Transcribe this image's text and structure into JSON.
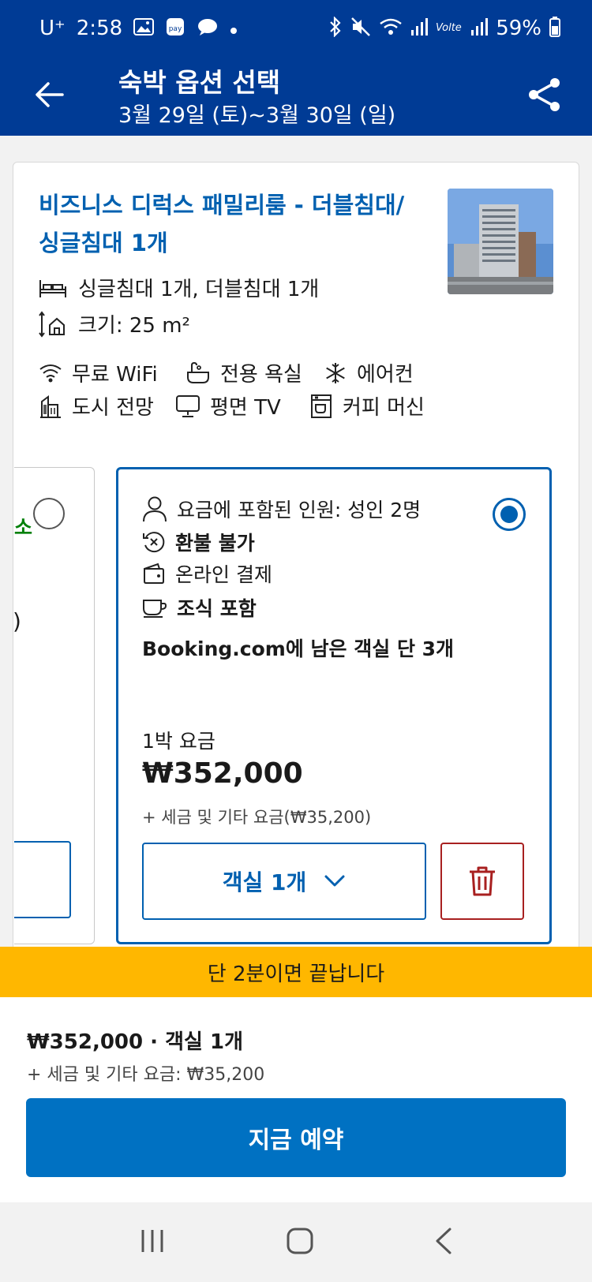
{
  "status_bar": {
    "carrier": "U⁺",
    "time": "2:58",
    "battery": "59%"
  },
  "header": {
    "title": "숙박 옵션 선택",
    "dates": "3월 29일 (토)~3월 30일 (일)"
  },
  "room": {
    "title": "비즈니스 디럭스 패밀리룸 - 더블침대/싱글침대 1개",
    "beds": "싱글침대 1개, 더블침대 1개",
    "size": "크기: 25 m²",
    "facilities": {
      "wifi": "무료 WiFi",
      "bath": "전용 욕실",
      "aircon": "에어컨",
      "view": "도시 전망",
      "tv": "평면 TV",
      "coffee": "커피 머신"
    }
  },
  "left_option": {
    "partial_text": "소",
    "partial_paren": ")"
  },
  "selected_option": {
    "guests": "요금에 포함된 인원: 성인 2명",
    "refund": "환불 불가",
    "payment": "온라인 결제",
    "breakfast": "조식 포함",
    "availability": "Booking.com에 남은 객실 단 3개",
    "price_label": "1박 요금",
    "price": "₩352,000",
    "tax_note": "+ 세금 및 기타 요금(₩35,200)",
    "room_count": "객실 1개"
  },
  "promo": {
    "text": "단 2분이면 끝납니다"
  },
  "footer": {
    "summary": "₩352,000 · 객실 1개",
    "tax": "+ 세금 및 기타 요금: ₩35,200",
    "book_button": "지금 예약"
  },
  "colors": {
    "brand_dark": "#003b95",
    "link_blue": "#0060b0",
    "cta_blue": "#0071c2",
    "promo_yellow": "#ffb700",
    "danger_red": "#a82020",
    "success_green": "#008009"
  }
}
